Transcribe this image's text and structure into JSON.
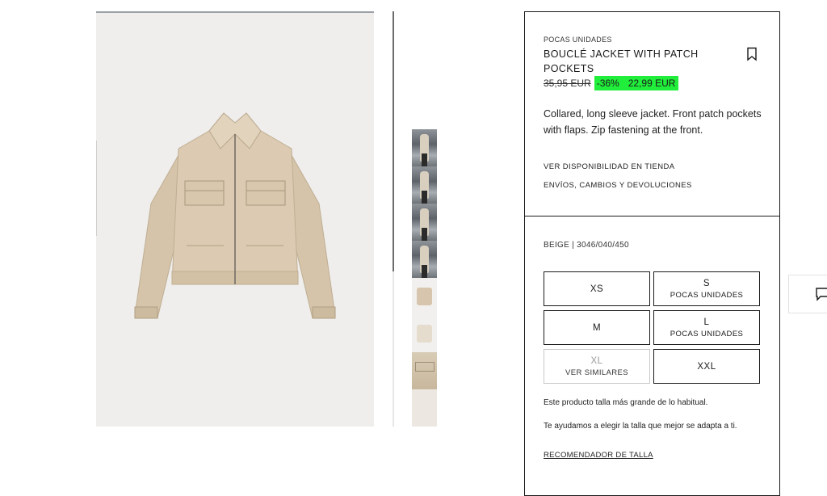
{
  "product": {
    "stock_note": "POCAS UNIDADES",
    "title": "BOUCLÉ JACKET WITH PATCH POCKETS",
    "old_price": "35,95 EUR",
    "discount": "-36%",
    "new_price": "22,99 EUR",
    "description": "Collared, long sleeve jacket. Front patch pockets with flaps. Zip fastening at the front.",
    "store_availability_link": "VER DISPONIBILIDAD EN TIENDA",
    "shipping_link": "ENVÍOS, CAMBIOS Y DEVOLUCIONES",
    "color_ref": "BEIGE | 3046/040/450"
  },
  "sizes": [
    {
      "label": "XS",
      "note": ""
    },
    {
      "label": "S",
      "note": "POCAS UNIDADES"
    },
    {
      "label": "M",
      "note": ""
    },
    {
      "label": "L",
      "note": "POCAS UNIDADES"
    },
    {
      "label": "XL",
      "note": "VER SIMILARES",
      "available": false
    },
    {
      "label": "XXL",
      "note": ""
    }
  ],
  "fit": {
    "note": "Este producto talla más grande de lo habitual.",
    "help": "Te ayudamos a elegir la talla que mejor se adapta a ti.",
    "recommender_link": "RECOMENDADOR DE TALLA"
  },
  "gallery": {
    "thumbnails": [
      "model-photo",
      "model-photo",
      "model-photo",
      "model-photo",
      "flat-product",
      "flat-product-pale",
      "detail-closeup",
      "detail-sleeve"
    ]
  },
  "icons": {
    "bookmark": "bookmark-icon",
    "chat": "chat-icon"
  },
  "colors": {
    "price_highlight": "#20ee3a",
    "jacket": "#d7c6ad"
  }
}
